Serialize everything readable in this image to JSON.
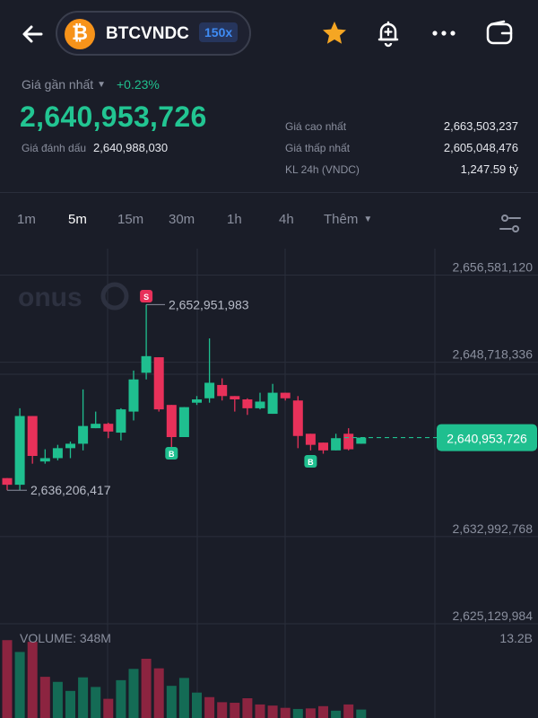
{
  "header": {
    "pair": "BTCVNDC",
    "leverage": "150x",
    "coin_symbol": "₿",
    "icons": [
      "back-arrow-icon",
      "bitcoin-icon",
      "star-icon",
      "bell-add-icon",
      "more-icon",
      "wallet-icon"
    ],
    "colors": {
      "star": "#f5a623",
      "bitcoin": "#f7931a",
      "leverage_text": "#3f8cf5"
    }
  },
  "price": {
    "last_label": "Giá gần nhất",
    "change": "+0.23%",
    "last_price": "2,640,953,726",
    "mark_label": "Giá đánh dấu",
    "mark_price": "2,640,988,030",
    "stats": [
      {
        "label": "Giá cao nhất",
        "value": "2,663,503,237"
      },
      {
        "label": "Giá thấp nhất",
        "value": "2,605,048,476"
      },
      {
        "label": "KL 24h (VNDC)",
        "value": "1,247.59 tỷ"
      }
    ],
    "colors": {
      "up": "#22c592"
    }
  },
  "timeframes": {
    "tabs": [
      "1m",
      "5m",
      "15m",
      "30m",
      "1h",
      "4h"
    ],
    "active": "5m",
    "more": "Thêm"
  },
  "chart": {
    "watermark": "onus",
    "y_labels": [
      "2,656,581,120",
      "2,648,718,336",
      "2,632,992,768",
      "2,625,129,984"
    ],
    "current_price": "2,640,953,726",
    "high_marker": "2,652,951,983",
    "low_marker": "2,636,206,417",
    "sell_badge": "S",
    "buy_badge": "B",
    "volume_label": "VOLUME: 348M",
    "volume_max": "13.2B",
    "colors": {
      "up": "#1fbf8f",
      "down": "#e8315a",
      "grid": "#2a2e3b"
    }
  },
  "chart_data": {
    "type": "candlestick",
    "y_range": [
      2624000000,
      2658000000
    ],
    "candles": [
      {
        "o": 2637300000,
        "h": 2637300000,
        "l": 2636206417,
        "c": 2636700000
      },
      {
        "o": 2636700000,
        "h": 2643600000,
        "l": 2636206417,
        "c": 2642900000
      },
      {
        "o": 2642900000,
        "h": 2642900000,
        "l": 2638600000,
        "c": 2639300000
      },
      {
        "o": 2638800000,
        "h": 2639900000,
        "l": 2638600000,
        "c": 2639100000
      },
      {
        "o": 2639100000,
        "h": 2640300000,
        "l": 2638900000,
        "c": 2640000000
      },
      {
        "o": 2640000000,
        "h": 2640600000,
        "l": 2639100000,
        "c": 2640400000
      },
      {
        "o": 2640400000,
        "h": 2645300000,
        "l": 2639800000,
        "c": 2642000000
      },
      {
        "o": 2641800000,
        "h": 2643300000,
        "l": 2641800000,
        "c": 2642200000
      },
      {
        "o": 2642200000,
        "h": 2642300000,
        "l": 2640900000,
        "c": 2641500000
      },
      {
        "o": 2641400000,
        "h": 2643600000,
        "l": 2640700000,
        "c": 2643500000
      },
      {
        "o": 2643300000,
        "h": 2647000000,
        "l": 2642500000,
        "c": 2646200000
      },
      {
        "o": 2646800000,
        "h": 2652951983,
        "l": 2646200000,
        "c": 2648300000
      },
      {
        "o": 2648200000,
        "h": 2648200000,
        "l": 2643300000,
        "c": 2643500000
      },
      {
        "o": 2643900000,
        "h": 2643900000,
        "l": 2639700000,
        "c": 2641000000
      },
      {
        "o": 2641000000,
        "h": 2643700000,
        "l": 2641000000,
        "c": 2643700000
      },
      {
        "o": 2644100000,
        "h": 2644700000,
        "l": 2643900000,
        "c": 2644400000
      },
      {
        "o": 2644500000,
        "h": 2649900000,
        "l": 2644100000,
        "c": 2645900000
      },
      {
        "o": 2645700000,
        "h": 2646300000,
        "l": 2644300000,
        "c": 2644700000
      },
      {
        "o": 2644700000,
        "h": 2644700000,
        "l": 2643300000,
        "c": 2644400000
      },
      {
        "o": 2644400000,
        "h": 2644500000,
        "l": 2643000000,
        "c": 2643600000
      },
      {
        "o": 2643600000,
        "h": 2645000000,
        "l": 2643500000,
        "c": 2644200000
      },
      {
        "o": 2643100000,
        "h": 2645800000,
        "l": 2643100000,
        "c": 2645000000
      },
      {
        "o": 2645000000,
        "h": 2645000000,
        "l": 2644300000,
        "c": 2644500000
      },
      {
        "o": 2644300000,
        "h": 2644700000,
        "l": 2640000000,
        "c": 2641100000
      },
      {
        "o": 2641300000,
        "h": 2641300000,
        "l": 2639800000,
        "c": 2640300000
      },
      {
        "o": 2640500000,
        "h": 2640500000,
        "l": 2639500000,
        "c": 2639800000
      },
      {
        "o": 2639800000,
        "h": 2641300000,
        "l": 2639800000,
        "c": 2640900000
      },
      {
        "o": 2641300000,
        "h": 2641800000,
        "l": 2639800000,
        "c": 2639900000
      },
      {
        "o": 2640400000,
        "h": 2641000000,
        "l": 2640400000,
        "c": 2640953726
      }
    ],
    "volume_range": [
      0,
      13.2
    ],
    "volumes": [
      {
        "v": 13.8,
        "up": false
      },
      {
        "v": 11.7,
        "up": true
      },
      {
        "v": 13.5,
        "up": false
      },
      {
        "v": 7.3,
        "up": false
      },
      {
        "v": 6.4,
        "up": true
      },
      {
        "v": 4.8,
        "up": true
      },
      {
        "v": 7.2,
        "up": true
      },
      {
        "v": 5.5,
        "up": true
      },
      {
        "v": 3.4,
        "up": false
      },
      {
        "v": 6.7,
        "up": true
      },
      {
        "v": 8.7,
        "up": true
      },
      {
        "v": 10.5,
        "up": false
      },
      {
        "v": 8.8,
        "up": false
      },
      {
        "v": 5.7,
        "up": true
      },
      {
        "v": 7.1,
        "up": true
      },
      {
        "v": 4.5,
        "up": true
      },
      {
        "v": 3.7,
        "up": false
      },
      {
        "v": 2.8,
        "up": false
      },
      {
        "v": 2.7,
        "up": false
      },
      {
        "v": 3.5,
        "up": false
      },
      {
        "v": 2.4,
        "up": false
      },
      {
        "v": 2.2,
        "up": false
      },
      {
        "v": 1.8,
        "up": false
      },
      {
        "v": 1.6,
        "up": true
      },
      {
        "v": 1.7,
        "up": false
      },
      {
        "v": 2.1,
        "up": false
      },
      {
        "v": 1.3,
        "up": true
      },
      {
        "v": 2.4,
        "up": false
      },
      {
        "v": 1.5,
        "up": true
      }
    ]
  }
}
